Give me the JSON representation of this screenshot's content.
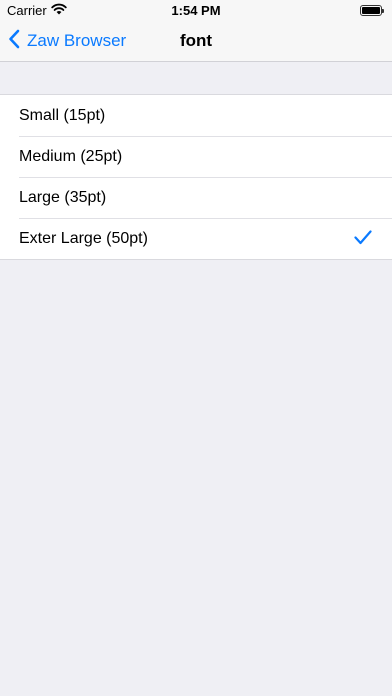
{
  "status_bar": {
    "carrier": "Carrier",
    "time": "1:54 PM",
    "wifi_icon": "wifi-icon",
    "battery_icon": "battery-icon"
  },
  "nav": {
    "back_label": "Zaw Browser",
    "back_icon": "chevron-left-icon",
    "title": "font"
  },
  "font_options": [
    {
      "label": "Small (15pt)",
      "selected": false
    },
    {
      "label": "Medium (25pt)",
      "selected": false
    },
    {
      "label": "Large (35pt)",
      "selected": false
    },
    {
      "label": "Exter Large (50pt)",
      "selected": true
    }
  ],
  "colors": {
    "accent": "#0a7aff",
    "background": "#efeff4",
    "cell": "#ffffff"
  }
}
